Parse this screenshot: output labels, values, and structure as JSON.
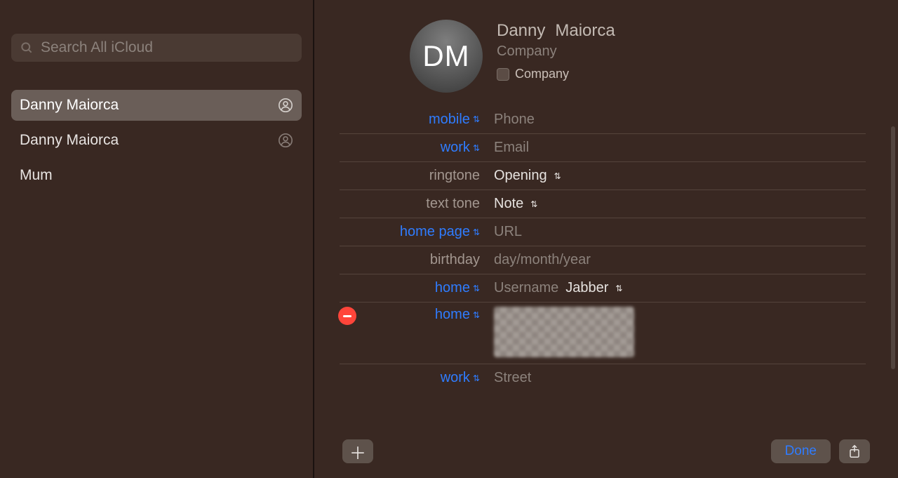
{
  "sidebar": {
    "search_placeholder": "Search All iCloud",
    "items": [
      {
        "label": "Danny  Maiorca",
        "selected": true,
        "has_icon": true
      },
      {
        "label": "Danny Maiorca",
        "selected": false,
        "has_icon": true
      },
      {
        "label": "Mum",
        "selected": false,
        "has_icon": false
      }
    ]
  },
  "contact": {
    "avatar_initials": "DM",
    "first_name": "Danny",
    "last_name": "Maiorca",
    "company_placeholder": "Company",
    "company_checkbox_label": "Company"
  },
  "rows": [
    {
      "kind": "link",
      "label": "mobile",
      "value_ph": "Phone"
    },
    {
      "kind": "link",
      "label": "work",
      "value_ph": "Email"
    },
    {
      "kind": "plain",
      "label": "ringtone",
      "value": "Opening",
      "value_chev": true
    },
    {
      "kind": "plain",
      "label": "text tone",
      "value": "Note",
      "value_chev": true
    },
    {
      "kind": "link",
      "label": "home page",
      "value_ph": "URL"
    },
    {
      "kind": "plain_nochev",
      "label": "birthday",
      "value_ph": "day/month/year"
    },
    {
      "kind": "link",
      "label": "home",
      "value_ph": "Username",
      "value2": "Jabber",
      "value2_chev": true
    },
    {
      "kind": "link",
      "label": "home",
      "deletable": true,
      "pixelated": true,
      "tall": true
    },
    {
      "kind": "link",
      "label": "work",
      "value_ph": "Street"
    }
  ],
  "buttons": {
    "done": "Done"
  }
}
